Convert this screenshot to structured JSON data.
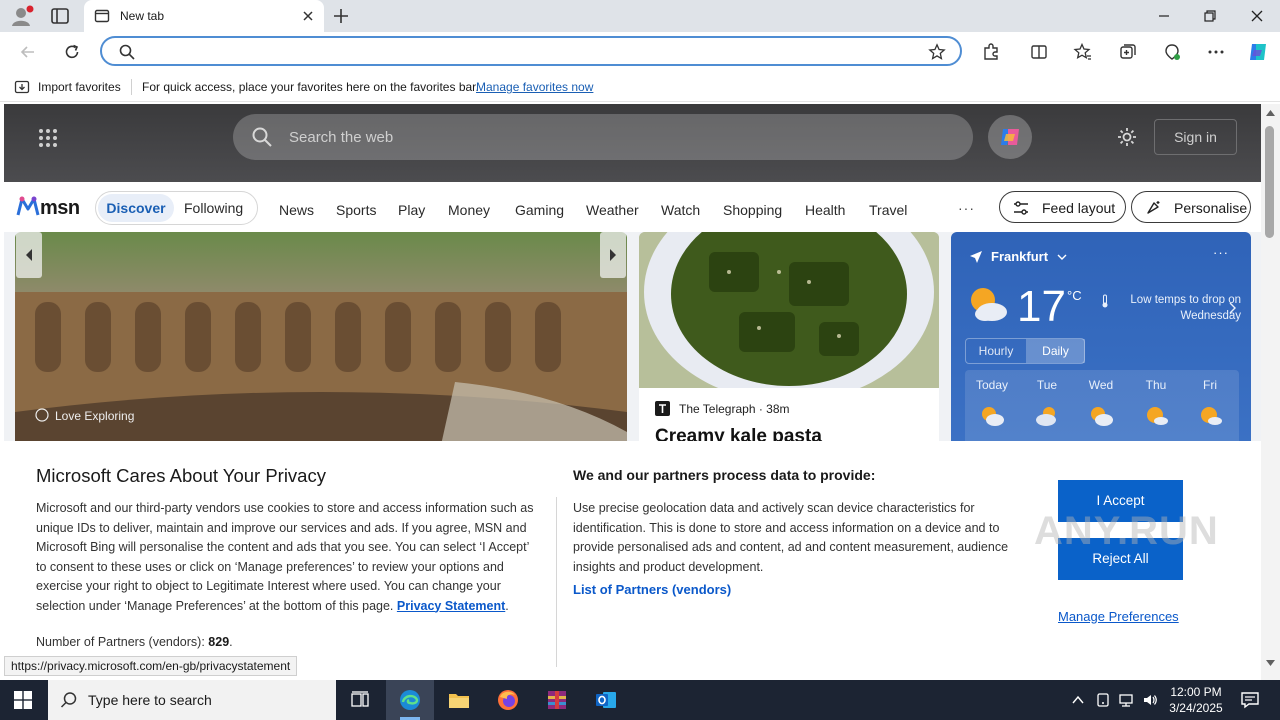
{
  "browser": {
    "tab_title": "New tab",
    "address_value": "",
    "favbar": {
      "import_label": "Import favorites",
      "hint": "For quick access, place your favorites here on the favorites bar.",
      "manage_link": "Manage favorites now"
    },
    "status_url": "https://privacy.microsoft.com/en-gb/privacystatement"
  },
  "msn": {
    "search_placeholder": "Search the web",
    "sign_in": "Sign in",
    "logo_text": "msn",
    "discover": "Discover",
    "following": "Following",
    "nav": [
      "News",
      "Sports",
      "Play",
      "Money",
      "Gaming",
      "Weather",
      "Watch",
      "Shopping",
      "Health",
      "Travel"
    ],
    "more": "···",
    "feed_layout": "Feed layout",
    "personalise": "Personalise",
    "hero_source": "Love Exploring",
    "food": {
      "publisher": "The Telegraph",
      "time": "38m",
      "headline": "Creamy kale pasta"
    },
    "weather": {
      "location": "Frankfurt",
      "temp": "17",
      "unit": "°C",
      "alert": "Low temps to drop on Wednesday",
      "tab_hourly": "Hourly",
      "tab_daily": "Daily",
      "days": [
        "Today",
        "Tue",
        "Wed",
        "Thu",
        "Fri"
      ]
    }
  },
  "privacy": {
    "title": "Microsoft Cares About Your Privacy",
    "body": "Microsoft and our third-party vendors use cookies to store and access information such as unique IDs to deliver, maintain and improve our services and ads. If you agree, MSN and Microsoft Bing will personalise the content and ads that you see. You can select ‘I Accept’ to consent to these uses or click on ‘Manage preferences’ to review your options and exercise your right to object to Legitimate Interest where used.  You can change your selection under ‘Manage Preferences’ at the bottom of this page.",
    "statement_link": "Privacy Statement",
    "partners_label": "Number of Partners (vendors):",
    "partners_count": "829",
    "title2": "We and our partners process data to provide:",
    "body2": "Use precise geolocation data and actively scan device characteristics for identification. This is done to store and access information on a device and to provide personalised ads and content, ad and content measurement, audience insights and product development.",
    "vendors_link": "List of Partners (vendors)",
    "accept": "I Accept",
    "reject": "Reject All",
    "manage": "Manage Preferences"
  },
  "watermark": "ANY.RUN",
  "taskbar": {
    "search_text": "Type here to search",
    "time": "12:00 PM",
    "date": "3/24/2025"
  },
  "colors": {
    "accent": "#0a62c9",
    "weather_bg": "#2f63b8",
    "taskbar": "#1c2433"
  }
}
